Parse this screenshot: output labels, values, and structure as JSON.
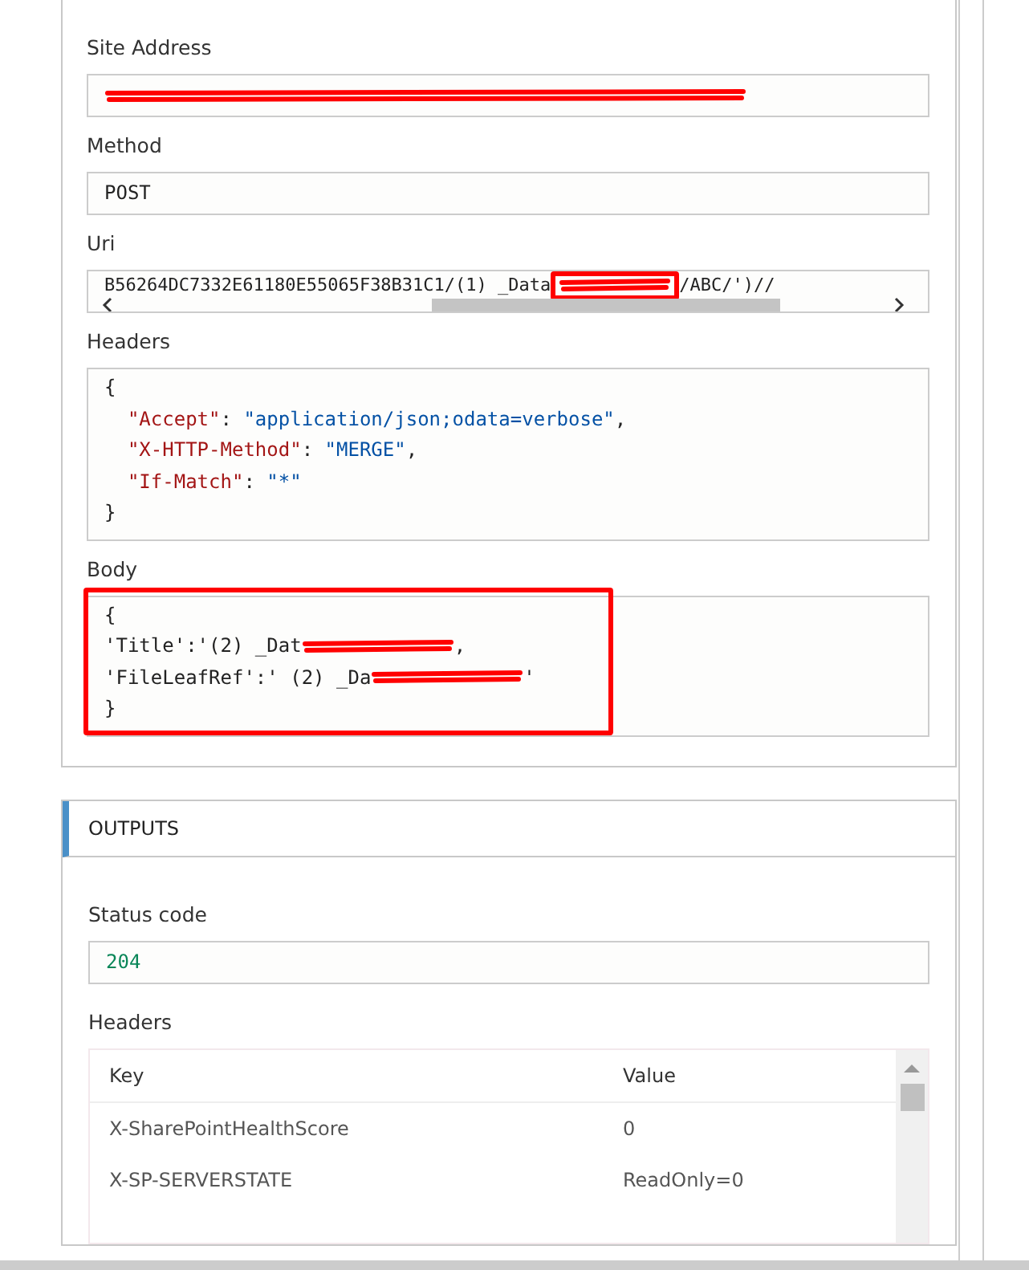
{
  "inputs": {
    "fields": [
      {
        "kind": "text",
        "label": "Site Address",
        "redacted": true
      },
      {
        "kind": "text",
        "label": "Method",
        "value": "POST"
      },
      {
        "kind": "uri",
        "label": "Uri",
        "before": "B56264DC7332E61180E55065F38B31C1/(1) _Data",
        "after": "/ABC/')//",
        "redacted": true,
        "highlighted": true
      },
      {
        "kind": "json",
        "label": "Headers",
        "lines": [
          [
            {
              "kind": "punct",
              "t": "{"
            }
          ],
          [
            {
              "kind": "key",
              "t": "  \"Accept\""
            },
            {
              "kind": "punct",
              "t": ": "
            },
            {
              "kind": "string",
              "t": "\"application/json;odata=verbose\""
            },
            {
              "kind": "punct",
              "t": ","
            }
          ],
          [
            {
              "kind": "key",
              "t": "  \"X-HTTP-Method\""
            },
            {
              "kind": "punct",
              "t": ": "
            },
            {
              "kind": "string",
              "t": "\"MERGE\""
            },
            {
              "kind": "punct",
              "t": ","
            }
          ],
          [
            {
              "kind": "key",
              "t": "  \"If-Match\""
            },
            {
              "kind": "punct",
              "t": ": "
            },
            {
              "kind": "string",
              "t": "\"*\""
            }
          ],
          [
            {
              "kind": "punct",
              "t": "}"
            }
          ]
        ]
      },
      {
        "kind": "body",
        "label": "Body",
        "highlighted": true,
        "lines": [
          {
            "before": "{"
          },
          {
            "before": "'Title':'(2) _Dat",
            "redacted": true,
            "after": ","
          },
          {
            "before": "'FileLeafRef':' (2) _Da",
            "redacted": true,
            "after": "'"
          },
          {
            "before": "}"
          }
        ]
      }
    ]
  },
  "outputs": {
    "title": "OUTPUTS",
    "status": {
      "label": "Status code",
      "value": "204"
    },
    "headers": {
      "label": "Headers",
      "columns": [
        "Key",
        "Value"
      ],
      "rows": [
        [
          "X-SharePointHealthScore",
          "0"
        ],
        [
          "X-SP-SERVERSTATE",
          "ReadOnly=0"
        ]
      ]
    }
  }
}
